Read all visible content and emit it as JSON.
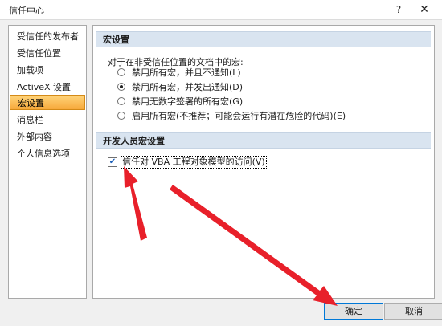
{
  "window": {
    "title": "信任中心",
    "help_glyph": "?",
    "close_glyph": "✕"
  },
  "sidebar": {
    "items": [
      {
        "label": "受信任的发布者"
      },
      {
        "label": "受信任位置"
      },
      {
        "label": "加载项"
      },
      {
        "label": "ActiveX 设置"
      },
      {
        "label": "宏设置",
        "selected": true
      },
      {
        "label": "消息栏"
      },
      {
        "label": "外部内容"
      },
      {
        "label": "个人信息选项"
      }
    ]
  },
  "macro_settings": {
    "header": "宏设置",
    "description": "对于在非受信任位置的文档中的宏:",
    "options": [
      {
        "label": "禁用所有宏，并且不通知(L)",
        "selected": false
      },
      {
        "label": "禁用所有宏，并发出通知(D)",
        "selected": true
      },
      {
        "label": "禁用无数字签署的所有宏(G)",
        "selected": false
      },
      {
        "label": "启用所有宏(不推荐；可能会运行有潜在危险的代码)(E)",
        "selected": false
      }
    ]
  },
  "developer": {
    "header": "开发人员宏设置",
    "trust_vba_label": "信任对 VBA 工程对象模型的访问(V)",
    "trust_vba_checked": true
  },
  "buttons": {
    "ok": "确定",
    "cancel": "取消"
  },
  "colors": {
    "annotation_arrow": "#e8202a",
    "selected_item": "#f7a93b",
    "section_header": "#d9e4f0"
  }
}
